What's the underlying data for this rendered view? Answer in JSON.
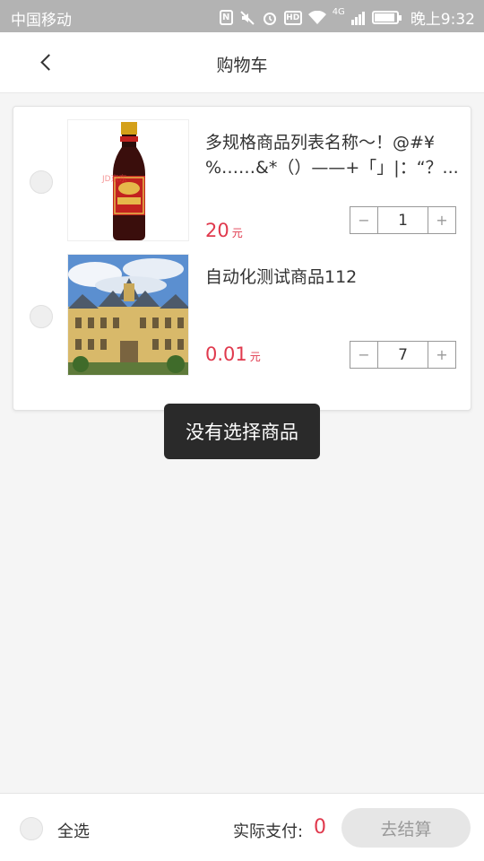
{
  "status_bar": {
    "carrier": "中国移动",
    "time": "晚上9:32",
    "network": "4G"
  },
  "header": {
    "title": "购物车"
  },
  "cart": {
    "items": [
      {
        "name": "多规格商品列表名称～！@#¥%……&*（）——+「」|：“？...",
        "price": "20",
        "unit": "元",
        "quantity": "1",
        "image": "soy-sauce-bottle",
        "image_watermark": "JD京东"
      },
      {
        "name": "自动化测试商品112",
        "price": "0.01",
        "unit": "元",
        "quantity": "7",
        "image": "mansion-building"
      }
    ],
    "minus_symbol": "−",
    "plus_symbol": "+"
  },
  "toast": {
    "message": "没有选择商品"
  },
  "footer": {
    "select_all_label": "全选",
    "pay_label": "实际支付:",
    "pay_value": "0",
    "checkout_label": "去结算"
  },
  "colors": {
    "price": "#e0394d",
    "checkout_disabled_bg": "#e6e6e6",
    "toast_bg": "#2a2a2a"
  }
}
